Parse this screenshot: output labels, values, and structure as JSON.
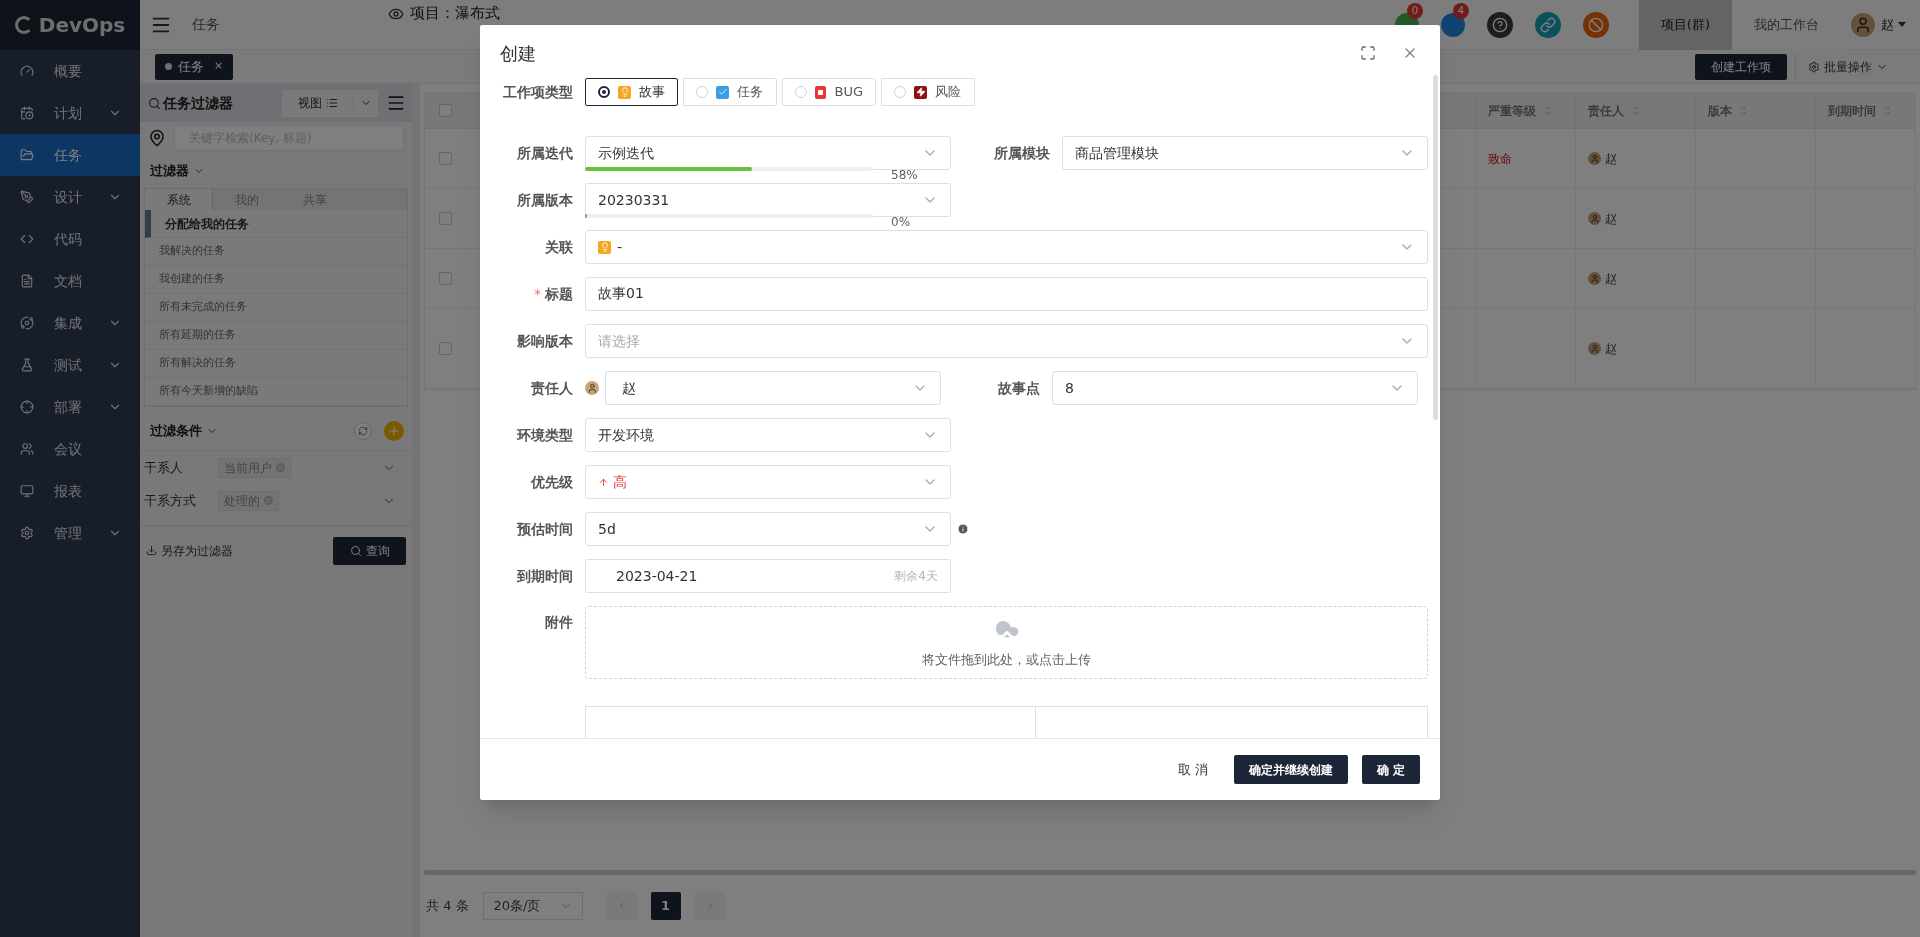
{
  "sidebar": {
    "logo": "DevOps",
    "items": [
      {
        "label": "概要",
        "expandable": false,
        "selected": false
      },
      {
        "label": "计划",
        "expandable": true,
        "selected": false
      },
      {
        "label": "任务",
        "expandable": false,
        "selected": true
      },
      {
        "label": "设计",
        "expandable": true,
        "selected": false
      },
      {
        "label": "代码",
        "expandable": false,
        "selected": false
      },
      {
        "label": "文档",
        "expandable": false,
        "selected": false
      },
      {
        "label": "集成",
        "expandable": true,
        "selected": false
      },
      {
        "label": "测试",
        "expandable": true,
        "selected": false
      },
      {
        "label": "部署",
        "expandable": true,
        "selected": false
      },
      {
        "label": "会议",
        "expandable": false,
        "selected": false
      },
      {
        "label": "报表",
        "expandable": false,
        "selected": false
      },
      {
        "label": "管理",
        "expandable": true,
        "selected": false
      }
    ]
  },
  "topbar": {
    "breadcrumb": "任务",
    "project": "项目：瀑布式",
    "notifications": [
      {
        "count": "0"
      },
      {
        "count": "4"
      }
    ],
    "nav_tabs": [
      {
        "label": "项目(群)",
        "selected": true
      },
      {
        "label": "我的工作台",
        "selected": false
      }
    ],
    "user": "赵"
  },
  "page_tabs": [
    {
      "label": "任务",
      "close": "×",
      "selected": true
    }
  ],
  "toolbar": {
    "create": "创建工作项",
    "batch": "批量操作"
  },
  "filter_panel": {
    "title": "任务过滤器",
    "view_button": "视图",
    "search_placeholder": "关键字检索(Key, 标题)",
    "filters_heading": "过滤器",
    "filter_tabs": [
      {
        "label": "系统",
        "selected": true
      },
      {
        "label": "我的",
        "selected": false
      },
      {
        "label": "共享",
        "selected": false
      }
    ],
    "filters": [
      {
        "label": "分配给我的任务",
        "selected": true
      },
      {
        "label": "我解决的任务",
        "selected": false
      },
      {
        "label": "我创建的任务",
        "selected": false
      },
      {
        "label": "所有未完成的任务",
        "selected": false
      },
      {
        "label": "所有延期的任务",
        "selected": false
      },
      {
        "label": "所有解决的任务",
        "selected": false
      },
      {
        "label": "所有今天新增的缺陷",
        "selected": false
      }
    ],
    "conditions_heading": "过滤条件",
    "conditions": [
      {
        "label": "干系人",
        "tag": "当前用户"
      },
      {
        "label": "干系方式",
        "tag": "处理的"
      }
    ],
    "save_link": "另存为过滤器",
    "query_button": "查询"
  },
  "table": {
    "select_all": {
      "checked": false
    },
    "columns": [
      "严重等级",
      "责任人",
      "版本",
      "到期时间"
    ],
    "rows": [
      {
        "checked": false,
        "severity": "致命",
        "assignee": "赵"
      },
      {
        "checked": false,
        "assignee": "赵"
      },
      {
        "checked": false,
        "assignee": "赵"
      },
      {
        "checked": false,
        "assignee": "赵"
      }
    ]
  },
  "pagination": {
    "total": "共 4 条",
    "page_size": "20条/页",
    "pages": [
      {
        "label": "1",
        "selected": true
      }
    ]
  },
  "dialog": {
    "title": "创建",
    "type_label": "工作项类型",
    "required_mark": "*",
    "types": [
      {
        "label": "故事",
        "kind": "story",
        "selected": true
      },
      {
        "label": "任务",
        "kind": "task",
        "selected": false
      },
      {
        "label": "BUG",
        "kind": "bug",
        "selected": false
      },
      {
        "label": "风险",
        "kind": "risk",
        "selected": false
      }
    ],
    "rows": [
      [
        {
          "label": "所属迭代",
          "value": "示例迭代",
          "kind": "progress",
          "level": 0.58,
          "reading": "58%",
          "required": false
        },
        {
          "label": "所属模块",
          "value": "商品管理模块",
          "kind": "select",
          "required": false
        }
      ],
      [
        {
          "label": "所属版本",
          "value": "20230331",
          "kind": "progress",
          "level": 0,
          "reading": "0%",
          "required": false
        }
      ],
      [
        {
          "label": "关联",
          "value": "-",
          "kind": "link",
          "wide": true,
          "required": false
        }
      ],
      [
        {
          "label": "标题",
          "value": "故事01",
          "kind": "text",
          "wide": true,
          "required": true
        }
      ],
      [
        {
          "label": "影响版本",
          "placeholder": "请选择",
          "kind": "select",
          "wide": true,
          "required": false
        }
      ],
      [
        {
          "label": "责任人",
          "value": "赵",
          "kind": "user",
          "required": false
        },
        {
          "label": "故事点",
          "value": "8",
          "kind": "select",
          "required": false
        }
      ],
      [
        {
          "label": "环境类型",
          "value": "开发环境",
          "kind": "select",
          "required": false
        }
      ],
      [
        {
          "label": "优先级",
          "value": "高",
          "kind": "priority",
          "required": false
        }
      ],
      [
        {
          "label": "预估时间",
          "value": "5d",
          "kind": "info",
          "required": false
        }
      ],
      [
        {
          "label": "到期时间",
          "value": "2023-04-21",
          "hint": "剩余4天",
          "kind": "date",
          "required": false
        }
      ],
      [
        {
          "label": "附件",
          "text": "将文件拖到此处，或点击上传",
          "kind": "upload",
          "required": false
        }
      ]
    ],
    "cancel": "取 消",
    "buttons": [
      "确定并继续创建",
      "确 定"
    ]
  }
}
